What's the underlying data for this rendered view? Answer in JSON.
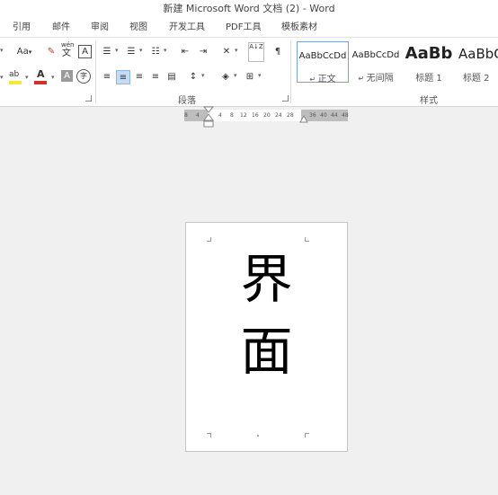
{
  "window": {
    "title": "新建 Microsoft Word 文档 (2) - Word"
  },
  "menu": {
    "items": [
      "引用",
      "邮件",
      "审阅",
      "视图",
      "开发工具",
      "PDF工具",
      "模板素材"
    ]
  },
  "ribbon": {
    "font_group": {
      "font_size_label": "Aa",
      "pinyin_label": "wén",
      "pinyin_char": "文",
      "border_char": "A",
      "highlight_label": "ab",
      "font_color_label": "A",
      "shade_char": "A",
      "enclose_char": "字"
    },
    "paragraph_group": {
      "label": "段落",
      "sort_label": "A↓Z"
    },
    "styles_group": {
      "label": "样式",
      "styles": [
        {
          "sample": "AaBbCcDd",
          "name": "正文",
          "selected": true
        },
        {
          "sample": "AaBbCcDd",
          "name": "无间隔",
          "selected": false
        },
        {
          "sample": "AaBb",
          "name": "标题 1",
          "selected": false
        },
        {
          "sample": "AaBbC",
          "name": "标题 2",
          "selected": false
        }
      ]
    }
  },
  "ruler": {
    "ticks": [
      "8",
      "4",
      "4",
      "8",
      "12",
      "16",
      "20",
      "24",
      "28",
      "36",
      "40",
      "44",
      "48"
    ]
  },
  "document": {
    "lines": [
      "界",
      "面"
    ]
  },
  "colors": {
    "highlight": "#f7e83a",
    "font_color": "#d0312d",
    "selected_style_border": "#7da2ce",
    "active_align_bg": "#c7dbf2"
  }
}
